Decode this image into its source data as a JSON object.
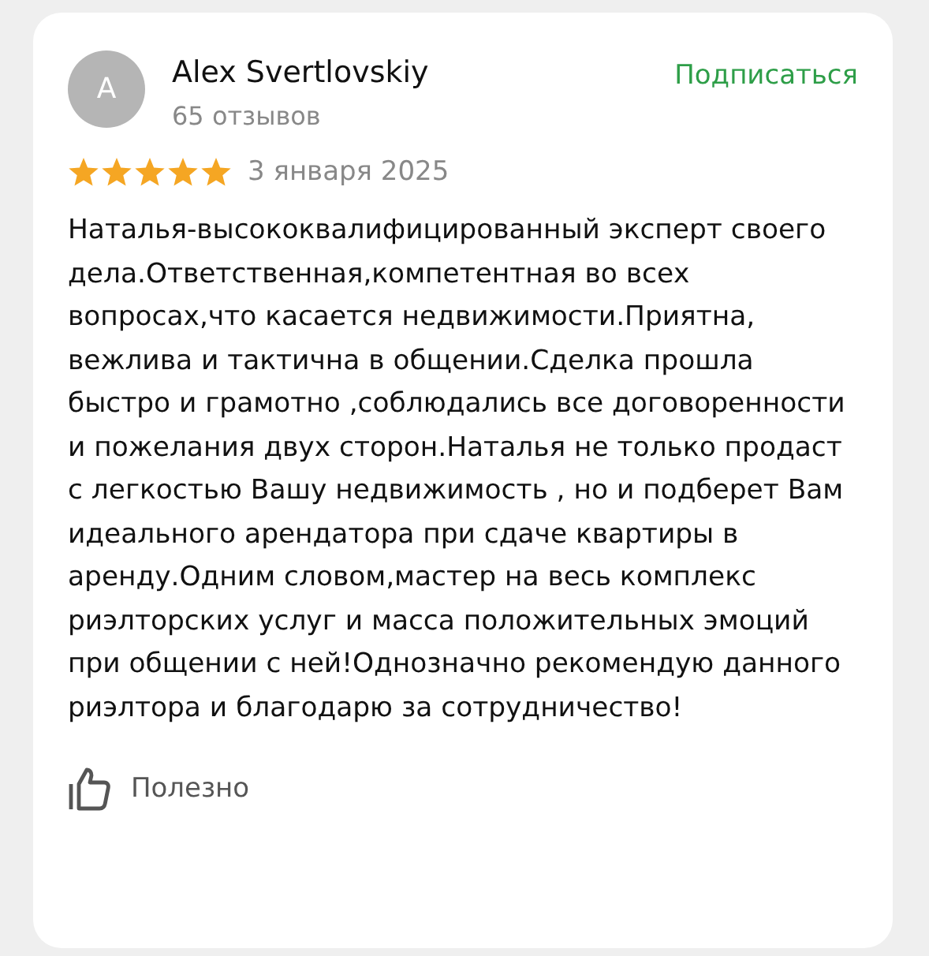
{
  "review": {
    "avatar": "A",
    "author": "Alex Svertlovskiy",
    "reviews_count": "65 отзывов",
    "subscribe": "Подписаться",
    "stars": 5,
    "date": "3 января 2025",
    "text": "Наталья-высококвалифицированный эксперт своего дела.Ответственная,компетентная во всех вопросах,что касается недвижимости.Приятна, вежлива и тактична в общении.Сделка прошла быстро и грамотно ,соблюдались все договоренности и пожелания двух сторон.Наталья не только продаст с легкостью Вашу недвижимость , но и подберет Вам идеального арендатора при сдаче квартиры в аренду.Одним словом,мастер на весь комплекс риэлторских услуг и масса положительных эмоций при общении с ней!Однозначно рекомендую данного риэлтора и благодарю за сотрудничество!",
    "helpful": "Полезно"
  }
}
